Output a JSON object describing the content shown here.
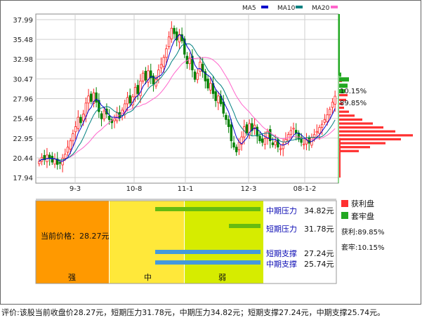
{
  "chart_data": {
    "type": "candlestick",
    "y_ticks": [
      "37.99",
      "35.48",
      "32.98",
      "30.47",
      "27.96",
      "25.46",
      "22.95",
      "20.44",
      "17.94"
    ],
    "ylim": [
      17.94,
      37.99
    ],
    "x_ticks": [
      "9-3",
      "10-8",
      "11-1",
      "12-3",
      "08-1-2"
    ],
    "legend": [
      {
        "name": "MA5",
        "color": "#0000cc"
      },
      {
        "name": "MA10",
        "color": "#008080"
      },
      {
        "name": "MA20",
        "color": "#ff66cc"
      }
    ],
    "colors": {
      "up": "#ff2020",
      "down": "#008000",
      "ma5": "#0000cc",
      "ma10": "#008080",
      "ma20": "#ff66cc",
      "profit": "#ff3030",
      "trap": "#22a822"
    },
    "closes": [
      20.0,
      20.5,
      20.2,
      20.8,
      20.4,
      19.9,
      20.3,
      19.6,
      19.8,
      20.4,
      20.9,
      21.8,
      22.6,
      23.5,
      24.4,
      25.6,
      24.9,
      26.0,
      27.4,
      28.3,
      27.6,
      28.7,
      27.5,
      26.3,
      25.4,
      26.4,
      26.0,
      25.3,
      24.9,
      25.4,
      26.2,
      25.6,
      26.5,
      27.3,
      28.1,
      27.4,
      28.2,
      29.4,
      28.6,
      30.2,
      31.2,
      30.3,
      31.5,
      30.6,
      29.8,
      30.4,
      31.6,
      32.3,
      33.2,
      34.3,
      35.8,
      36.9,
      36.2,
      35.4,
      36.1,
      35.3,
      33.6,
      32.4,
      33.1,
      31.6,
      30.4,
      31.2,
      32.6,
      31.4,
      30.2,
      29.3,
      29.9,
      28.6,
      27.7,
      28.3,
      27.3,
      26.1,
      25.3,
      24.4,
      22.6,
      21.8,
      21.2,
      22.4,
      23.1,
      24.4,
      23.6,
      24.8,
      23.9,
      24.6,
      23.2,
      22.6,
      22.4,
      22.9,
      23.8,
      22.6,
      22.1,
      22.5,
      21.8,
      21.6,
      22.2,
      22.8,
      23.4,
      23.9,
      24.2,
      23.6,
      22.8,
      22.4,
      22.2,
      22.7,
      22.3,
      23.0,
      23.4,
      23.8,
      24.3,
      24.7,
      25.3,
      25.9,
      26.6,
      27.5,
      28.27
    ]
  },
  "profit_bars": [
    {
      "price": 30.2,
      "len": 4
    },
    {
      "price": 29.6,
      "len": 6
    },
    {
      "price": 29.0,
      "len": 9
    },
    {
      "price": 28.4,
      "len": 12
    },
    {
      "price": 27.8,
      "len": 10
    },
    {
      "price": 27.3,
      "len": 5
    },
    {
      "price": 26.8,
      "len": 7
    },
    {
      "price": 26.3,
      "len": 14
    },
    {
      "price": 25.8,
      "len": 22
    },
    {
      "price": 25.3,
      "len": 33
    },
    {
      "price": 24.8,
      "len": 48
    },
    {
      "price": 24.3,
      "len": 63
    },
    {
      "price": 23.8,
      "len": 80
    },
    {
      "price": 23.3,
      "len": 105
    },
    {
      "price": 22.8,
      "len": 88
    },
    {
      "price": 22.3,
      "len": 66
    },
    {
      "price": 21.8,
      "len": 44
    },
    {
      "price": 21.3,
      "len": 28
    }
  ],
  "trap_bars": [
    {
      "price": 31.0,
      "len": 3
    },
    {
      "price": 30.4,
      "len": 14
    },
    {
      "price": 29.6,
      "len": 12
    },
    {
      "price": 28.9,
      "len": 8
    }
  ],
  "chip_labels": {
    "trap_pct": "10.15%",
    "profit_pct": "89.85%"
  },
  "panel": {
    "current_price_label": "当前价格：28.27元",
    "rows": [
      {
        "label": "中期压力",
        "value": "34.82元",
        "color": "#66bb11"
      },
      {
        "label": "短期压力",
        "value": "31.78元",
        "color": "#66bb11"
      },
      {
        "label": "短期支撑",
        "value": "27.24元",
        "color": "#4499dd"
      },
      {
        "label": "中期支撑",
        "value": "25.74元",
        "color": "#4499dd"
      }
    ],
    "zones": [
      "强",
      "中",
      "弱"
    ],
    "legend": [
      {
        "label": "获利盘",
        "color": "#ff3030"
      },
      {
        "label": "套牢盘",
        "color": "#22a822"
      }
    ],
    "profit_line": "获利:89.85%",
    "trap_line": "套牢:10.15%"
  },
  "footer": "评价:该股当前收盘价28.27元，短期压力31.78元，中期压力34.82元；短期支撑27.24元，中期支撑25.74元。"
}
